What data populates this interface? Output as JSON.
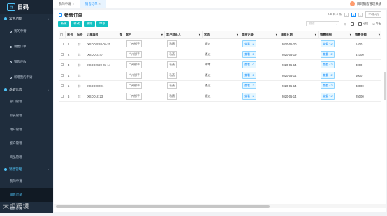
{
  "app": {
    "logo_text": "日码",
    "logo_mark": "日"
  },
  "sidebar": {
    "groups": [
      {
        "label": "常用功能",
        "items": [
          "我的申请",
          "销售订单",
          "销售应收",
          "新增我的申请"
        ]
      },
      {
        "label": "基础信息",
        "items": [
          "部门管理",
          "职员管理",
          "用户管理",
          "客户管理",
          "商品管理"
        ]
      },
      {
        "label": "销售管理",
        "items": [
          "我的申请",
          "销售订单",
          "销售应收"
        ]
      }
    ]
  },
  "topbar": {
    "tabs": [
      {
        "label": "我的申请"
      },
      {
        "label": "销售订单"
      }
    ],
    "user": "日码销售管理系统"
  },
  "page": {
    "title": "销售订单",
    "pagination": {
      "range": "1-6 共 6 条",
      "page": "1",
      "page_size": "20 条/页"
    },
    "toolbar": {
      "new": "新建",
      "edit": "修改",
      "delete": "删除",
      "audit": "审核"
    },
    "search_placeholder": "搜索...",
    "tools": {
      "filter": "",
      "query": "",
      "group": "分组",
      "export": "导出"
    }
  },
  "table": {
    "columns": [
      "序号",
      "标签",
      "订单编号",
      "客户",
      "客户联系人",
      "状态",
      "审核记录",
      "单据日期",
      "销售明细",
      "销售金额"
    ],
    "rows": [
      {
        "idx": "1",
        "order": "XSDD2020-05-20",
        "customer": "广州镖手",
        "contact": "马燕",
        "status": "通过",
        "audit": "查看 · 2",
        "date": "2020-05-20",
        "detail": "查看 · 2",
        "amount": "1400"
      },
      {
        "idx": "2",
        "order": "XSDD15:47",
        "customer": "广州镖手",
        "contact": "马燕",
        "status": "通过",
        "audit": "查看 · 2",
        "date": "2020-05-19",
        "detail": "查看 · 2",
        "amount": "31000"
      },
      {
        "idx": "3",
        "order": "XSDD2020-05-14",
        "customer": "广州镖手",
        "contact": "马燕",
        "status": "待审",
        "audit": "查看 · 0",
        "date": "2020-05-14",
        "detail": "查看 · 2",
        "amount": "3000"
      },
      {
        "idx": "4",
        "order": "",
        "customer": "广州镖手",
        "contact": "马燕",
        "status": "通过",
        "audit": "查看 · 2",
        "date": "2020-05-14",
        "detail": "查看 · 2",
        "amount": "4000"
      },
      {
        "idx": "5",
        "order": "XSDD00001",
        "customer": "广州镖手",
        "contact": "马燕",
        "status": "通过",
        "audit": "查看 · 2",
        "date": "2020-05-14",
        "detail": "查看 · 2",
        "amount": "33000"
      },
      {
        "idx": "6",
        "order": "XSDD18:23",
        "customer": "广州镖手",
        "contact": "马燕",
        "status": "通过",
        "audit": "查看 · 2",
        "date": "2020-05-14",
        "detail": "查看 · 2",
        "amount": "25000"
      }
    ]
  },
  "watermark": "大殿跨境",
  "colors": {
    "accent": "#13c2c2",
    "sidebar": "#1f2d3d",
    "link": "#1890ff"
  }
}
